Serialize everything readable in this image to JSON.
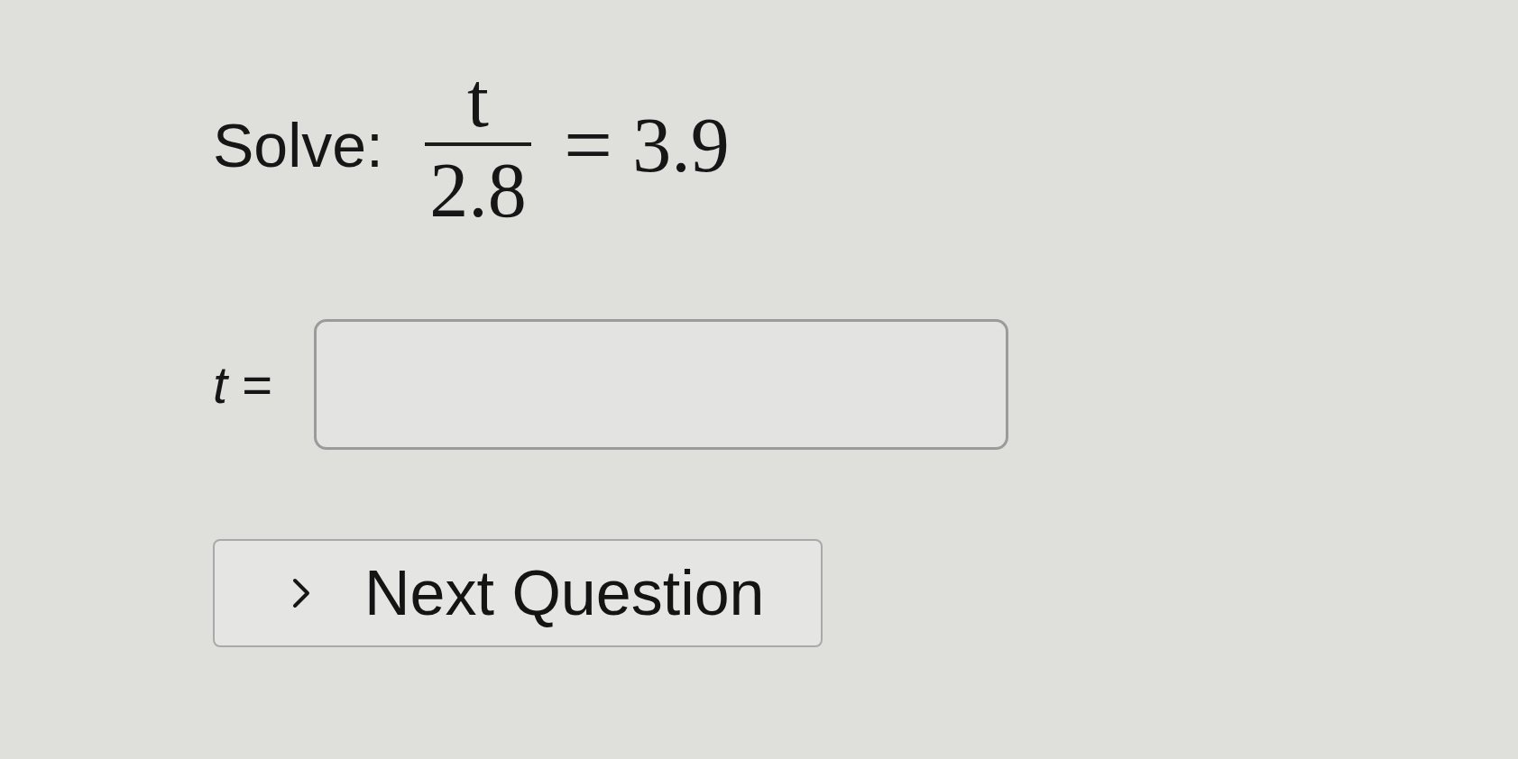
{
  "problem": {
    "label": "Solve:",
    "equation": {
      "numerator": "t",
      "denominator": "2.8",
      "relation": "=",
      "right_side": "3.9"
    }
  },
  "answer": {
    "label": "*t* ="
  },
  "next_button": {
    "label": "Next Question"
  }
}
